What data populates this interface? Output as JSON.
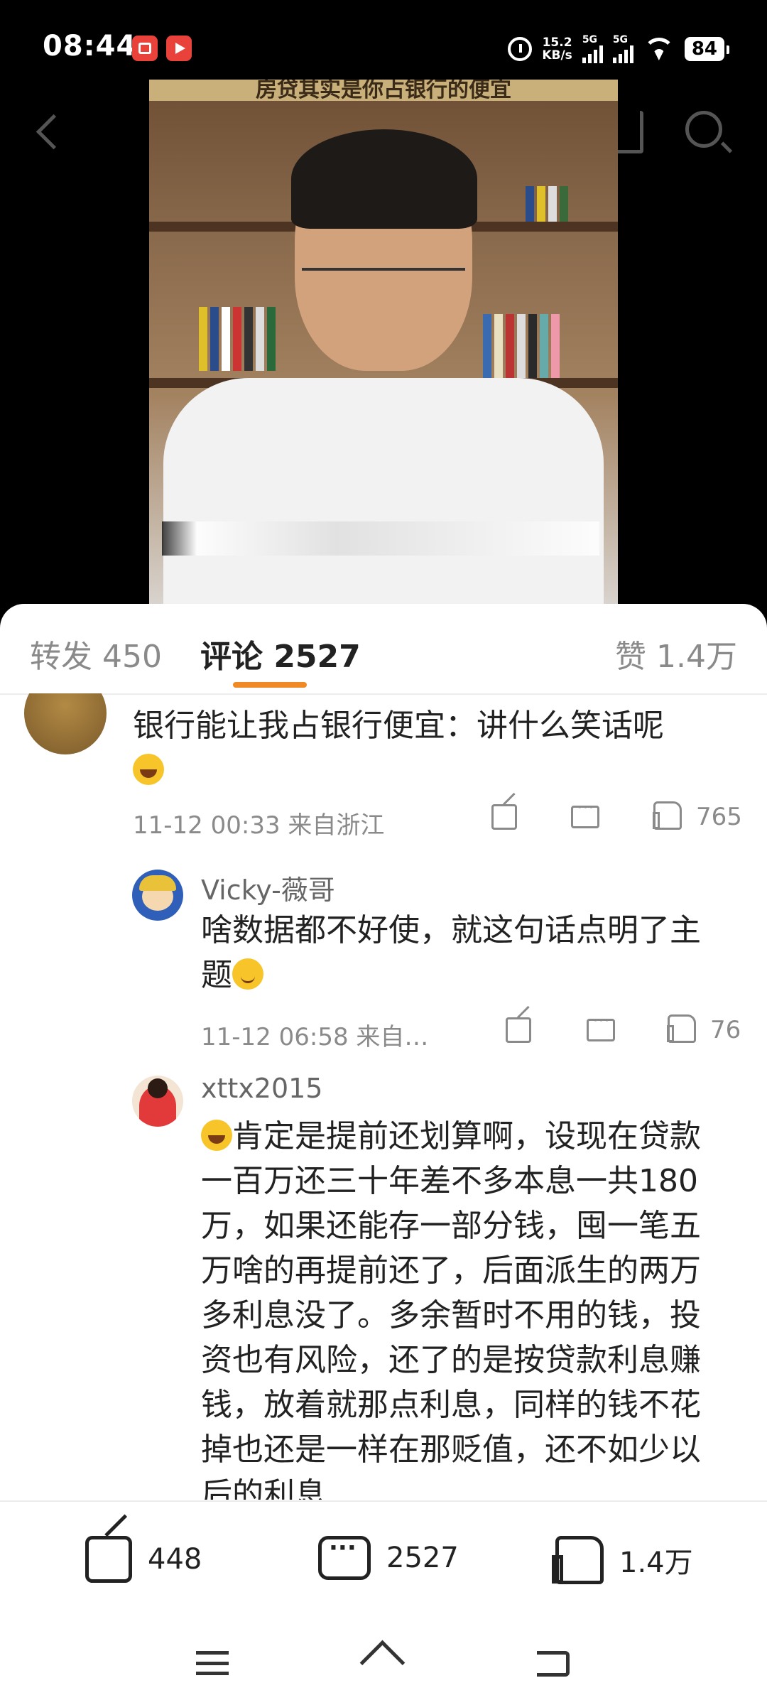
{
  "status_bar": {
    "time": "08:44",
    "net_speed": "15.2",
    "net_unit": "KB/s",
    "sim1": "5G",
    "sim2": "5G",
    "battery": "84"
  },
  "video": {
    "caption": "房贷其实是你占银行的便宜"
  },
  "tabs": {
    "repost": "转发 450",
    "comments": "评论 2527",
    "likes": "赞 1.4万"
  },
  "comments": [
    {
      "text": "银行能让我占银行便宜：讲什么笑话呢",
      "emoji": "laugh-cry",
      "time": "11-12 00:33",
      "location": "来自浙江",
      "likes": "765"
    },
    {
      "username": "Vicky-薇哥",
      "text": "啥数据都不好使，就这句话点明了主题",
      "emoji": "smile",
      "time": "11-12 06:58",
      "location": "来自…",
      "likes": "76"
    },
    {
      "username": "xttx2015",
      "emoji": "laugh-cry",
      "text": "肯定是提前还划算啊，设现在贷款一百万还三十年差不多本息一共180万，如果还能存一部分钱，囤一笔五万啥的再提前还了，后面派生的两万多利息没了。多余暂时不用的钱，投资也有风险，还了的是按贷款利息赚钱，放着就那点利息，同样的钱不花掉也还是一样在那贬值，还不如少以后的利息"
    }
  ],
  "action_bar": {
    "repost": "448",
    "comments": "2527",
    "likes": "1.4万"
  },
  "icons": {
    "share": "share-icon",
    "comment": "comment-icon",
    "like": "thumbs-up-icon",
    "back": "back-arrow-icon",
    "search": "search-icon",
    "scan": "scan-icon"
  },
  "colors": {
    "accent": "#f08a24",
    "text": "#222222",
    "muted": "#8a8a8a"
  }
}
